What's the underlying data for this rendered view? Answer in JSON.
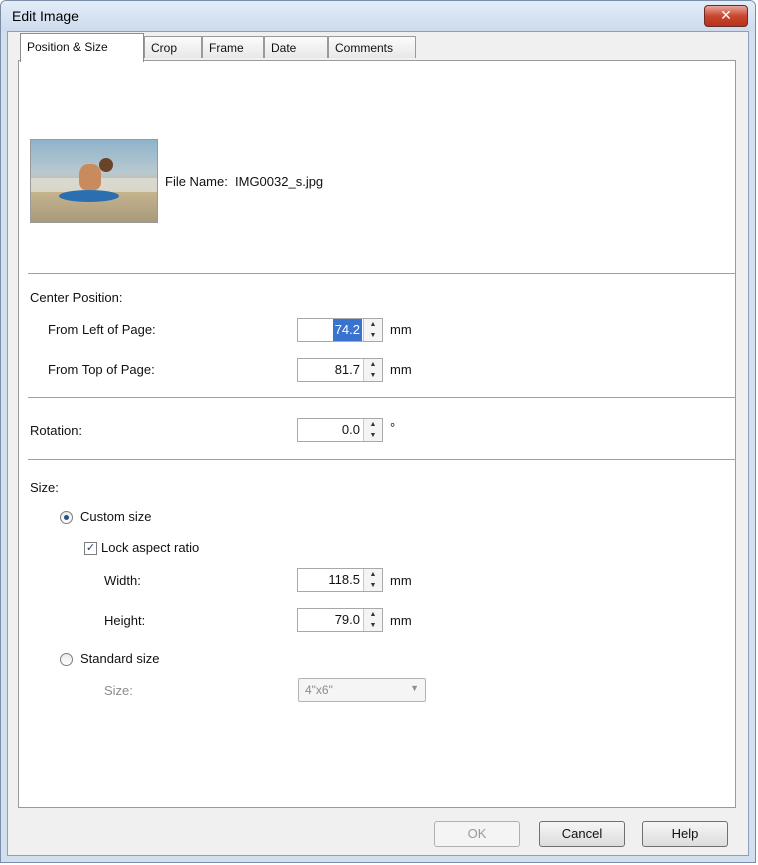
{
  "window": {
    "title": "Edit Image",
    "close_glyph": "✕"
  },
  "tabs": [
    {
      "label": "Position & Size",
      "active": true
    },
    {
      "label": "Crop"
    },
    {
      "label": "Frame"
    },
    {
      "label": "Date"
    },
    {
      "label": "Comments"
    }
  ],
  "file": {
    "label": "File Name:",
    "value": "IMG0032_s.jpg"
  },
  "center_position": {
    "heading": "Center Position:",
    "from_left": {
      "label": "From Left of Page:",
      "value": "74.2",
      "unit": "mm"
    },
    "from_top": {
      "label": "From Top of Page:",
      "value": "81.7",
      "unit": "mm"
    }
  },
  "rotation": {
    "label": "Rotation:",
    "value": "0.0",
    "unit": "°"
  },
  "size": {
    "heading": "Size:",
    "custom_size_label": "Custom size",
    "lock_aspect_label": "Lock aspect ratio",
    "width": {
      "label": "Width:",
      "value": "118.5",
      "unit": "mm"
    },
    "height": {
      "label": "Height:",
      "value": "79.0",
      "unit": "mm"
    },
    "standard_size_label": "Standard size",
    "standard_size_field_label": "Size:",
    "standard_size_value": "4\"x6\""
  },
  "buttons": {
    "ok": "OK",
    "cancel": "Cancel",
    "help": "Help"
  },
  "glyphs": {
    "spin_up": "▲",
    "spin_down": "▼",
    "dropdown": "▼",
    "check": "✓"
  }
}
